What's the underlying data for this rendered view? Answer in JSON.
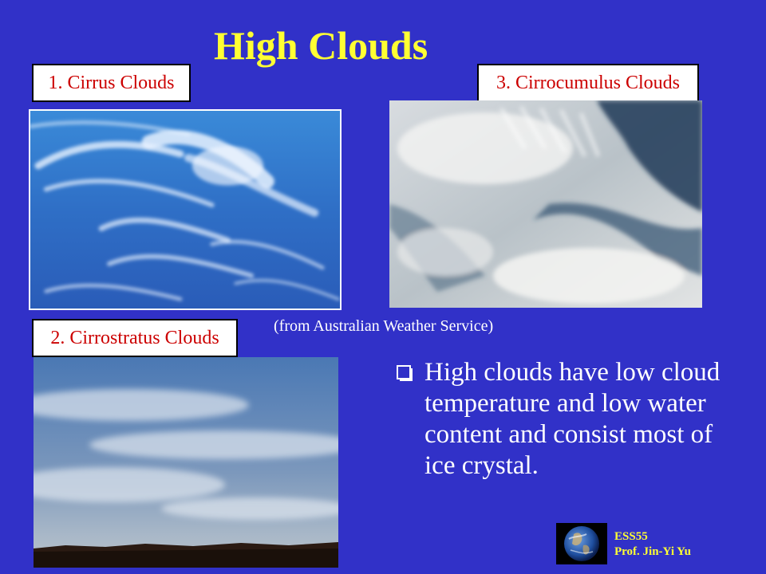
{
  "slide": {
    "title": "High Clouds",
    "labels": {
      "cirrus": "1. Cirrus Clouds",
      "cirrostratus": "2. Cirrostratus Clouds",
      "cirrocumulus": "3. Cirrocumulus Clouds"
    },
    "source": "(from Australian Weather Service)",
    "bullet": {
      "icon": "checkbox-bullet-icon",
      "text": "High clouds have low cloud temperature and low water content and consist most of ice crystal."
    },
    "footer": {
      "course": "ESS55",
      "instructor": "Prof. Jin-Yi Yu",
      "logo": "earth-globe-icon"
    },
    "colors": {
      "background": "#3131c8",
      "title": "#ffff33",
      "label_text": "#cc0000",
      "body_text": "#ffffff"
    }
  }
}
